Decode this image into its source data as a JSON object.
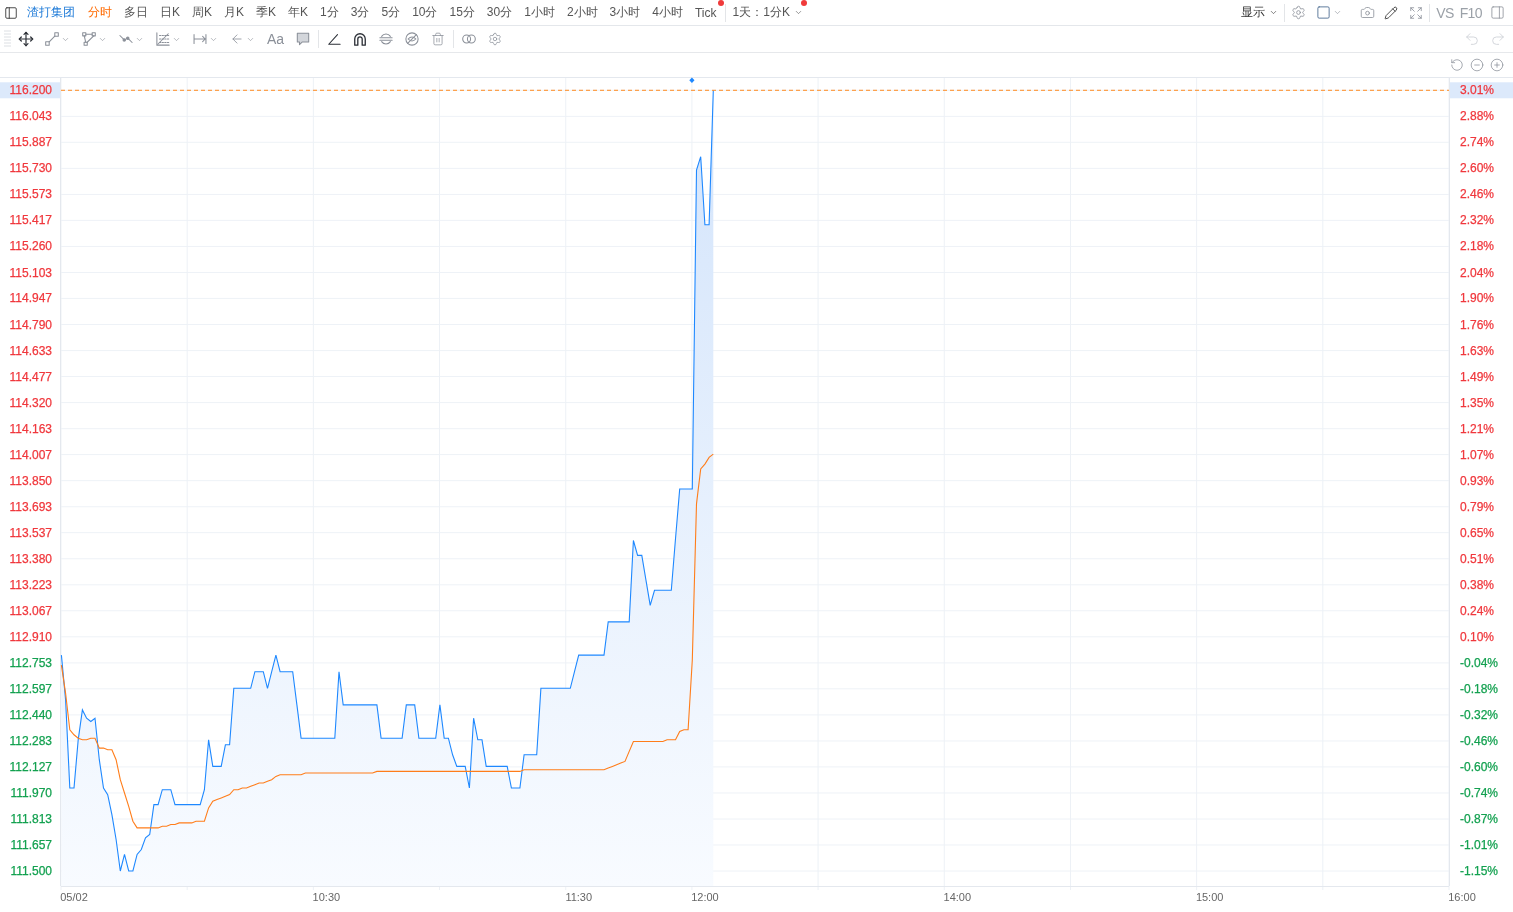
{
  "header": {
    "stock_name": "渣打集团",
    "periods": [
      {
        "label": "分时",
        "selected": true,
        "dot": false
      },
      {
        "label": "多日",
        "selected": false,
        "dot": false
      },
      {
        "label": "日K",
        "selected": false,
        "dot": false
      },
      {
        "label": "周K",
        "selected": false,
        "dot": false
      },
      {
        "label": "月K",
        "selected": false,
        "dot": false
      },
      {
        "label": "季K",
        "selected": false,
        "dot": false
      },
      {
        "label": "年K",
        "selected": false,
        "dot": false
      },
      {
        "label": "1分",
        "selected": false,
        "dot": false
      },
      {
        "label": "3分",
        "selected": false,
        "dot": false
      },
      {
        "label": "5分",
        "selected": false,
        "dot": false
      },
      {
        "label": "10分",
        "selected": false,
        "dot": false
      },
      {
        "label": "15分",
        "selected": false,
        "dot": false
      },
      {
        "label": "30分",
        "selected": false,
        "dot": false
      },
      {
        "label": "1小时",
        "selected": false,
        "dot": false
      },
      {
        "label": "2小时",
        "selected": false,
        "dot": false
      },
      {
        "label": "3小时",
        "selected": false,
        "dot": false
      },
      {
        "label": "4小时",
        "selected": false,
        "dot": false
      },
      {
        "label": "Tick",
        "selected": false,
        "dot": true
      }
    ],
    "range_menu": {
      "label": "1天：1分K",
      "dot": true
    },
    "display_menu": {
      "label": "显示"
    },
    "compare_label": "VS",
    "f10_label": "F10"
  },
  "toolbar": {
    "tool_groups": [
      {
        "tools": [
          {
            "kind": "move",
            "active": true,
            "menu": false
          },
          {
            "kind": "line",
            "active": false,
            "menu": true
          },
          {
            "kind": "polygon",
            "active": false,
            "menu": true
          },
          {
            "kind": "path",
            "active": false,
            "menu": true
          },
          {
            "kind": "grid",
            "active": false,
            "menu": true
          },
          {
            "kind": "measure",
            "active": false,
            "menu": true
          },
          {
            "kind": "arrow",
            "active": false,
            "menu": true
          },
          {
            "kind": "text",
            "label": "Aa",
            "active": false,
            "menu": false
          },
          {
            "kind": "note",
            "active": false,
            "menu": false
          }
        ]
      },
      {
        "tools": [
          {
            "kind": "angle",
            "active": true,
            "menu": false
          },
          {
            "kind": "magnet",
            "active": true,
            "menu": false
          },
          {
            "kind": "sync",
            "active": false,
            "menu": false
          },
          {
            "kind": "hide",
            "active": false,
            "menu": false
          },
          {
            "kind": "delete",
            "active": false,
            "menu": false
          }
        ]
      },
      {
        "tools": [
          {
            "kind": "link",
            "active": false,
            "menu": false
          },
          {
            "kind": "settings",
            "active": false,
            "menu": false
          }
        ]
      }
    ],
    "undo": {
      "disabled": true
    },
    "redo": {
      "disabled": true
    }
  },
  "chart": {
    "left_axis": [
      {
        "color": "#f0383d",
        "highlighted": true
      },
      {
        "color": "#f0383d",
        "highlighted": false
      },
      {
        "color": "#f0383d",
        "highlighted": false
      },
      {
        "color": "#f0383d",
        "highlighted": false
      },
      {
        "color": "#f0383d",
        "highlighted": false
      },
      {
        "color": "#f0383d",
        "highlighted": false
      },
      {
        "color": "#f0383d",
        "highlighted": false
      },
      {
        "color": "#f0383d",
        "highlighted": false
      },
      {
        "color": "#f0383d",
        "highlighted": false
      },
      {
        "color": "#f0383d",
        "highlighted": false
      },
      {
        "color": "#f0383d",
        "highlighted": false
      },
      {
        "color": "#f0383d",
        "highlighted": false
      },
      {
        "color": "#f0383d",
        "highlighted": false
      },
      {
        "color": "#f0383d",
        "highlighted": false
      },
      {
        "color": "#f0383d",
        "highlighted": false
      },
      {
        "color": "#f0383d",
        "highlighted": false
      },
      {
        "color": "#f0383d",
        "highlighted": false
      },
      {
        "color": "#f0383d",
        "highlighted": false
      },
      {
        "color": "#f0383d",
        "highlighted": false
      },
      {
        "color": "#f0383d",
        "highlighted": false
      },
      {
        "color": "#f0383d",
        "highlighted": false
      },
      {
        "color": "#f0383d",
        "highlighted": false
      },
      {
        "color": "#13a150",
        "highlighted": false
      },
      {
        "color": "#13a150",
        "highlighted": false
      },
      {
        "color": "#13a150",
        "highlighted": false
      },
      {
        "color": "#13a150",
        "highlighted": false
      },
      {
        "color": "#13a150",
        "highlighted": false
      },
      {
        "color": "#13a150",
        "highlighted": false
      },
      {
        "color": "#13a150",
        "highlighted": false
      },
      {
        "color": "#13a150",
        "highlighted": false
      },
      {
        "color": "#13a150",
        "highlighted": false
      }
    ],
    "right_axis": [
      {
        "label": "3.01%",
        "color": "#f0383d",
        "highlighted": true
      },
      {
        "label": "2.88%",
        "color": "#f0383d",
        "highlighted": false
      },
      {
        "label": "2.74%",
        "color": "#f0383d",
        "highlighted": false
      },
      {
        "label": "2.60%",
        "color": "#f0383d",
        "highlighted": false
      },
      {
        "label": "2.46%",
        "color": "#f0383d",
        "highlighted": false
      },
      {
        "label": "2.32%",
        "color": "#f0383d",
        "highlighted": false
      },
      {
        "label": "2.18%",
        "color": "#f0383d",
        "highlighted": false
      },
      {
        "label": "2.04%",
        "color": "#f0383d",
        "highlighted": false
      },
      {
        "label": "1.90%",
        "color": "#f0383d",
        "highlighted": false
      },
      {
        "label": "1.76%",
        "color": "#f0383d",
        "highlighted": false
      },
      {
        "label": "1.63%",
        "color": "#f0383d",
        "highlighted": false
      },
      {
        "label": "1.49%",
        "color": "#f0383d",
        "highlighted": false
      },
      {
        "label": "1.35%",
        "color": "#f0383d",
        "highlighted": false
      },
      {
        "label": "1.21%",
        "color": "#f0383d",
        "highlighted": false
      },
      {
        "label": "1.07%",
        "color": "#f0383d",
        "highlighted": false
      },
      {
        "label": "0.93%",
        "color": "#f0383d",
        "highlighted": false
      },
      {
        "label": "0.79%",
        "color": "#f0383d",
        "highlighted": false
      },
      {
        "label": "0.65%",
        "color": "#f0383d",
        "highlighted": false
      },
      {
        "label": "0.51%",
        "color": "#f0383d",
        "highlighted": false
      },
      {
        "label": "0.38%",
        "color": "#f0383d",
        "highlighted": false
      },
      {
        "label": "0.24%",
        "color": "#f0383d",
        "highlighted": false
      },
      {
        "label": "0.10%",
        "color": "#f0383d",
        "highlighted": false
      },
      {
        "label": "-0.04%",
        "color": "#13a150",
        "highlighted": false
      },
      {
        "label": "-0.18%",
        "color": "#13a150",
        "highlighted": false
      },
      {
        "label": "-0.32%",
        "color": "#13a150",
        "highlighted": false
      },
      {
        "label": "-0.46%",
        "color": "#13a150",
        "highlighted": false
      },
      {
        "label": "-0.60%",
        "color": "#13a150",
        "highlighted": false
      },
      {
        "label": "-0.74%",
        "color": "#13a150",
        "highlighted": false
      },
      {
        "label": "-0.87%",
        "color": "#13a150",
        "highlighted": false
      },
      {
        "label": "-1.01%",
        "color": "#13a150",
        "highlighted": false
      },
      {
        "label": "-1.15%",
        "color": "#13a150",
        "highlighted": false
      }
    ],
    "chart_data": {
      "type": "line",
      "grid": true,
      "ylim": [
        111.41,
        116.28
      ],
      "categories": [
        null,
        null,
        null,
        "05/02",
        null,
        null,
        null,
        null,
        null,
        null,
        null,
        null,
        null,
        null,
        null,
        null,
        null,
        null,
        null,
        null,
        null,
        null,
        null,
        null,
        null,
        null,
        null,
        null,
        null,
        null,
        null,
        null,
        null,
        null,
        null,
        null,
        null,
        null,
        null,
        null,
        null,
        null,
        null,
        null,
        null,
        null,
        null,
        null,
        null,
        null,
        null,
        null,
        null,
        null,
        null,
        null,
        null,
        null,
        null,
        null,
        null,
        null,
        null,
        "10:30",
        null,
        null,
        null,
        null,
        null,
        null,
        null,
        null,
        null,
        null,
        null,
        null,
        null,
        null,
        null,
        null,
        null,
        null,
        null,
        null,
        null,
        null,
        null,
        null,
        null,
        null,
        null,
        null,
        null,
        null,
        null,
        null,
        null,
        null,
        null,
        null,
        null,
        null,
        null,
        null,
        null,
        null,
        null,
        null,
        null,
        null,
        null,
        null,
        null,
        null,
        null,
        null,
        null,
        null,
        null,
        null,
        null,
        null,
        null,
        "11:30",
        null,
        null,
        null,
        null,
        null,
        null,
        null,
        null,
        null,
        null,
        null,
        null,
        null,
        null,
        null,
        null,
        null,
        null,
        null,
        null,
        null,
        null,
        null,
        null,
        null,
        null,
        null,
        null,
        null,
        "12:00",
        null,
        null,
        null,
        null,
        null,
        null,
        null,
        null,
        null,
        null,
        null,
        null,
        null,
        null,
        null,
        null,
        null,
        null,
        null,
        null,
        null,
        null,
        null,
        null,
        null,
        null,
        null,
        null,
        null,
        null,
        null,
        null,
        null,
        null,
        null,
        null,
        null,
        null,
        null,
        null,
        null,
        null,
        null,
        null,
        null,
        null,
        null,
        null,
        null,
        null,
        null,
        null,
        null,
        null,
        null,
        null,
        null,
        null,
        null,
        "14:00",
        null,
        null,
        null,
        null,
        null,
        null,
        null,
        null,
        null,
        null,
        null,
        null,
        null,
        null,
        null,
        null,
        null,
        null,
        null,
        null,
        null,
        null,
        null,
        null,
        null,
        null,
        null,
        null,
        null,
        null,
        null,
        null,
        null,
        null,
        null,
        null,
        null,
        null,
        null,
        null,
        null,
        null,
        null,
        null,
        null,
        null,
        null,
        null,
        null,
        null,
        null,
        null,
        null,
        null,
        null,
        null,
        null,
        null,
        null,
        "15:00",
        null,
        null,
        null,
        null,
        null,
        null,
        null,
        null,
        null,
        null,
        null,
        null,
        null,
        null,
        null,
        null,
        null,
        null,
        null,
        null,
        null,
        null,
        null,
        null,
        null,
        null,
        null,
        null,
        null,
        null,
        null,
        null,
        null,
        null,
        null,
        null,
        null,
        null,
        null,
        null,
        null,
        null,
        null,
        null,
        null,
        null,
        null,
        null,
        null,
        null,
        null,
        null,
        null,
        null,
        null,
        null,
        null,
        null,
        null,
        "16:00"
      ],
      "yticks": [
        {
          "value": 116.2,
          "label": "116.200"
        },
        {
          "value": 116.043,
          "label": "116.043"
        },
        {
          "value": 115.887,
          "label": "115.887"
        },
        {
          "value": 115.73,
          "label": "115.730"
        },
        {
          "value": 115.573,
          "label": "115.573"
        },
        {
          "value": 115.417,
          "label": "115.417"
        },
        {
          "value": 115.26,
          "label": "115.260"
        },
        {
          "value": 115.103,
          "label": "115.103"
        },
        {
          "value": 114.947,
          "label": "114.947"
        },
        {
          "value": 114.79,
          "label": "114.790"
        },
        {
          "value": 114.633,
          "label": "114.633"
        },
        {
          "value": 114.477,
          "label": "114.477"
        },
        {
          "value": 114.32,
          "label": "114.320"
        },
        {
          "value": 114.163,
          "label": "114.163"
        },
        {
          "value": 114.007,
          "label": "114.007"
        },
        {
          "value": 113.85,
          "label": "113.850"
        },
        {
          "value": 113.693,
          "label": "113.693"
        },
        {
          "value": 113.537,
          "label": "113.537"
        },
        {
          "value": 113.38,
          "label": "113.380"
        },
        {
          "value": 113.223,
          "label": "113.223"
        },
        {
          "value": 113.067,
          "label": "113.067"
        },
        {
          "value": 112.91,
          "label": "112.910"
        },
        {
          "value": 112.753,
          "label": "112.753"
        },
        {
          "value": 112.597,
          "label": "112.597"
        },
        {
          "value": 112.44,
          "label": "112.440"
        },
        {
          "value": 112.283,
          "label": "112.283"
        },
        {
          "value": 112.127,
          "label": "112.127"
        },
        {
          "value": 111.97,
          "label": "111.970"
        },
        {
          "value": 111.813,
          "label": "111.813"
        },
        {
          "value": 111.657,
          "label": "111.657"
        },
        {
          "value": 111.5,
          "label": "111.500"
        }
      ],
      "series": [
        {
          "color": "#1e88ff",
          "values": [
            112.8,
            112.53,
            112.0,
            112.0,
            112.29,
            112.47,
            112.42,
            112.4,
            112.42,
            112.17,
            112.0,
            111.96,
            111.84,
            111.69,
            111.5,
            111.6,
            111.5,
            111.5,
            111.6,
            111.63,
            111.7,
            111.72,
            111.9,
            111.9,
            111.99,
            111.99,
            111.99,
            111.9,
            111.9,
            111.9,
            111.9,
            111.9,
            111.9,
            111.9,
            111.99,
            112.29,
            112.13,
            112.13,
            112.13,
            112.26,
            112.26,
            112.6,
            112.6,
            112.6,
            112.6,
            112.6,
            112.7,
            112.7,
            112.7,
            112.6,
            112.7,
            112.8,
            112.7,
            112.7,
            112.7,
            112.7,
            112.5,
            112.3,
            112.3,
            112.3,
            112.3,
            112.3,
            112.3,
            112.3,
            112.3,
            112.3,
            112.7,
            112.5,
            112.5,
            112.5,
            112.5,
            112.5,
            112.5,
            112.5,
            112.5,
            112.5,
            112.3,
            112.3,
            112.3,
            112.3,
            112.3,
            112.3,
            112.5,
            112.5,
            112.5,
            112.3,
            112.3,
            112.3,
            112.3,
            112.3,
            112.5,
            112.3,
            112.3,
            112.2,
            112.13,
            112.13,
            112.13,
            112.0,
            112.42,
            112.29,
            112.29,
            112.13,
            112.13,
            112.13,
            112.13,
            112.13,
            112.13,
            112.0,
            112.0,
            112.0,
            112.2,
            112.2,
            112.2,
            112.2,
            112.6,
            112.6,
            112.6,
            112.6,
            112.6,
            112.6,
            112.6,
            112.6,
            112.7,
            112.8,
            112.8,
            112.8,
            112.8,
            112.8,
            112.8,
            112.8,
            113.0,
            113.0,
            113.0,
            113.0,
            113.0,
            113.0,
            113.49,
            113.4,
            113.4,
            113.25,
            113.1,
            113.19,
            113.19,
            113.19,
            113.19,
            113.19,
            113.5,
            113.8,
            113.8,
            113.8,
            113.8,
            115.72,
            115.8,
            115.39,
            115.39,
            116.2,
            null,
            null,
            null,
            null,
            null,
            null,
            null,
            null,
            null,
            null,
            null,
            null,
            null,
            null,
            null,
            null,
            null,
            null,
            null,
            null,
            null,
            null,
            null,
            null,
            null,
            null,
            null,
            null,
            null,
            null,
            null,
            null,
            null,
            null,
            null,
            null,
            null,
            null,
            null,
            null,
            null,
            null,
            null,
            null,
            null,
            null,
            null,
            null,
            null,
            null,
            null,
            null,
            null,
            null,
            null,
            null,
            null,
            null,
            null,
            null,
            null,
            null,
            null,
            null,
            null,
            null,
            null,
            null,
            null,
            null,
            null,
            null,
            null,
            null,
            null,
            null,
            null,
            null,
            null,
            null,
            null,
            null,
            null,
            null,
            null,
            null,
            null,
            null,
            null,
            null,
            null,
            null,
            null,
            null,
            null,
            null,
            null,
            null,
            null,
            null,
            null,
            null,
            null,
            null,
            null,
            null,
            null,
            null,
            null,
            null,
            null,
            null,
            null,
            null,
            null,
            null,
            null,
            null,
            null,
            null,
            null,
            null,
            null,
            null,
            null,
            null,
            null,
            null,
            null,
            null,
            null,
            null,
            null,
            null,
            null,
            null,
            null,
            null,
            null,
            null,
            null,
            null,
            null,
            null,
            null,
            null,
            null,
            null,
            null,
            null,
            null,
            null,
            null,
            null,
            null,
            null,
            null,
            null,
            null,
            null,
            null,
            null,
            null,
            null,
            null,
            null,
            null,
            null,
            null,
            null,
            null,
            null,
            null,
            null,
            null,
            null,
            null,
            null
          ]
        },
        {
          "color": "#ff7d1a",
          "values": [
            112.74,
            112.57,
            112.35,
            112.32,
            112.3,
            112.29,
            112.29,
            112.3,
            112.3,
            112.24,
            112.24,
            112.23,
            112.23,
            112.17,
            112.05,
            111.97,
            111.89,
            111.8,
            111.76,
            111.76,
            111.76,
            111.76,
            111.76,
            111.76,
            111.77,
            111.77,
            111.78,
            111.78,
            111.79,
            111.79,
            111.79,
            111.79,
            111.8,
            111.8,
            111.8,
            111.88,
            111.92,
            111.93,
            111.94,
            111.95,
            111.96,
            111.99,
            111.99,
            112.0,
            112.0,
            112.01,
            112.02,
            112.03,
            112.03,
            112.04,
            112.05,
            112.07,
            112.08,
            112.08,
            112.08,
            112.08,
            112.08,
            112.08,
            112.09,
            112.09,
            112.09,
            112.09,
            112.09,
            112.09,
            112.09,
            112.09,
            112.09,
            112.09,
            112.09,
            112.09,
            112.09,
            112.09,
            112.09,
            112.09,
            112.09,
            112.1,
            112.1,
            112.1,
            112.1,
            112.1,
            112.1,
            112.1,
            112.1,
            112.1,
            112.1,
            112.1,
            112.1,
            112.1,
            112.1,
            112.1,
            112.1,
            112.1,
            112.1,
            112.1,
            112.1,
            112.1,
            112.1,
            112.1,
            112.1,
            112.1,
            112.1,
            112.1,
            112.1,
            112.1,
            112.1,
            112.1,
            112.1,
            112.1,
            112.1,
            112.1,
            112.11,
            112.11,
            112.11,
            112.11,
            112.11,
            112.11,
            112.11,
            112.11,
            112.11,
            112.11,
            112.11,
            112.11,
            112.11,
            112.11,
            112.11,
            112.11,
            112.11,
            112.11,
            112.11,
            112.11,
            112.12,
            112.13,
            112.14,
            112.15,
            112.16,
            112.22,
            112.28,
            112.28,
            112.28,
            112.28,
            112.28,
            112.28,
            112.28,
            112.28,
            112.29,
            112.29,
            112.29,
            112.34,
            112.35,
            112.35,
            112.77,
            113.71,
            113.92,
            113.95,
            113.99,
            114.01,
            null,
            null,
            null,
            null,
            null,
            null,
            null,
            null,
            null,
            null,
            null,
            null,
            null,
            null,
            null,
            null,
            null,
            null,
            null,
            null,
            null,
            null,
            null,
            null,
            null,
            null,
            null,
            null,
            null,
            null,
            null,
            null,
            null,
            null,
            null,
            null,
            null,
            null,
            null,
            null,
            null,
            null,
            null,
            null,
            null,
            null,
            null,
            null,
            null,
            null,
            null,
            null,
            null,
            null,
            null,
            null,
            null,
            null,
            null,
            null,
            null,
            null,
            null,
            null,
            null,
            null,
            null,
            null,
            null,
            null,
            null,
            null,
            null,
            null,
            null,
            null,
            null,
            null,
            null,
            null,
            null,
            null,
            null,
            null,
            null,
            null,
            null,
            null,
            null,
            null,
            null,
            null,
            null,
            null,
            null,
            null,
            null,
            null,
            null,
            null,
            null,
            null,
            null,
            null,
            null,
            null,
            null,
            null,
            null,
            null,
            null,
            null,
            null,
            null,
            null,
            null,
            null,
            null,
            null,
            null,
            null,
            null,
            null,
            null,
            null,
            null,
            null,
            null,
            null,
            null,
            null,
            null,
            null,
            null,
            null,
            null,
            null,
            null,
            null,
            null,
            null,
            null,
            null,
            null,
            null,
            null,
            null,
            null,
            null,
            null,
            null,
            null,
            null,
            null,
            null,
            null,
            null,
            null,
            null,
            null,
            null,
            null,
            null,
            null,
            null,
            null,
            null,
            null,
            null,
            null,
            null,
            null,
            null,
            null,
            null,
            null,
            null,
            null
          ]
        }
      ],
      "ref_lines": [
        {
          "axis": "y",
          "value": 116.2,
          "color": "#ff8a1f"
        }
      ]
    }
  }
}
